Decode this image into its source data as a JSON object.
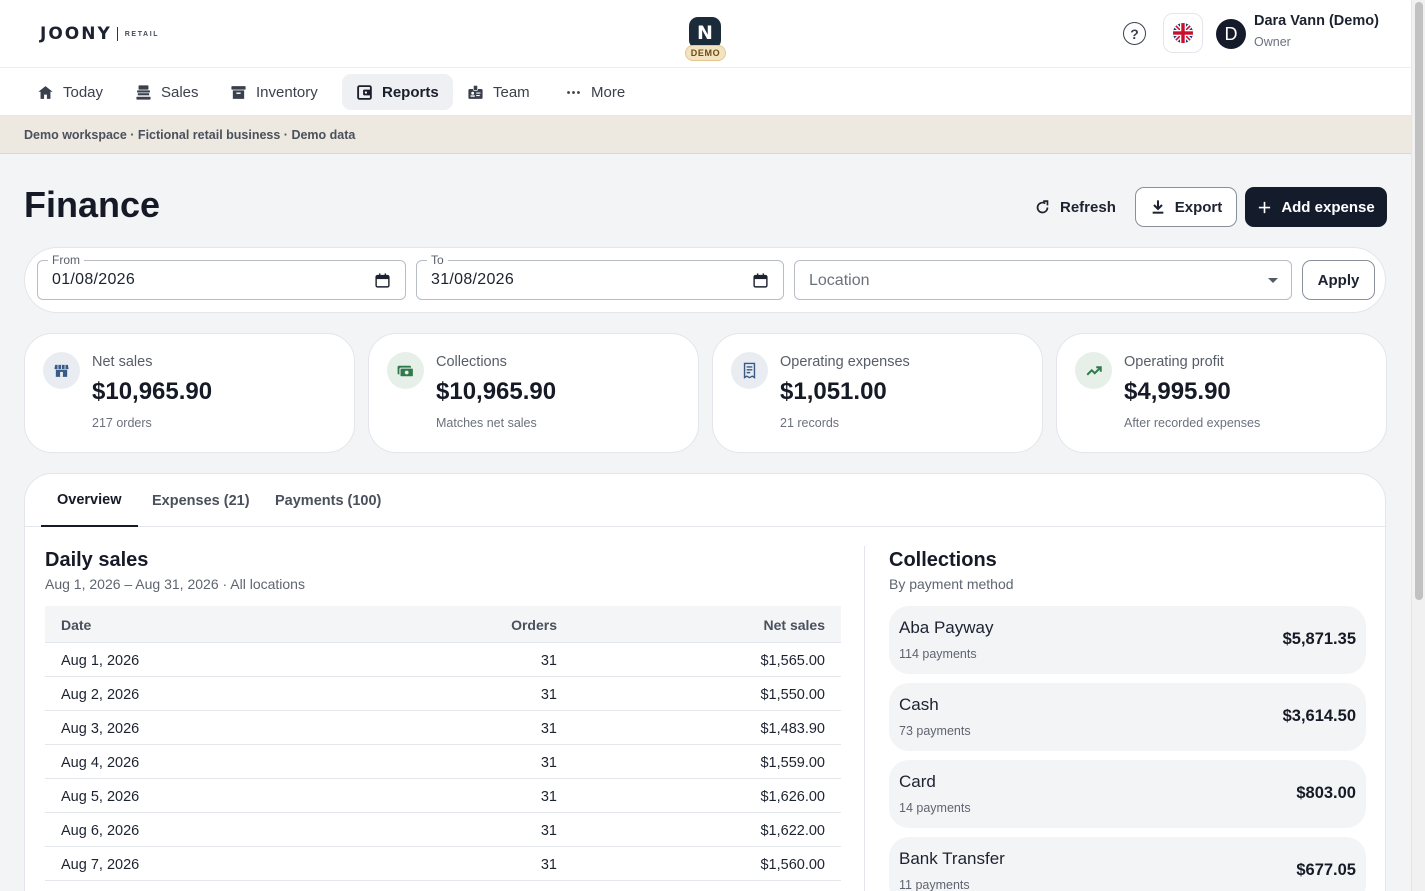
{
  "brand": {
    "name": "JOONY",
    "sub": "RETAIL"
  },
  "logo": {
    "letter": "N",
    "tag": "DEMO"
  },
  "header": {
    "help_icon": "help-circle-icon",
    "language_flag": "uk-flag-icon"
  },
  "user": {
    "initial": "D",
    "name": "Dara Vann (Demo)",
    "role": "Owner"
  },
  "nav": {
    "items": [
      {
        "label": "Today",
        "icon": "home-icon"
      },
      {
        "label": "Sales",
        "icon": "register-icon"
      },
      {
        "label": "Inventory",
        "icon": "archive-box-icon"
      },
      {
        "label": "Reports",
        "icon": "wallet-icon"
      },
      {
        "label": "Team",
        "icon": "badge-icon"
      },
      {
        "label": "More",
        "icon": "more-dots-icon"
      }
    ],
    "active": "Reports"
  },
  "banner": {
    "text": "Demo workspace · Fictional retail business · Demo data"
  },
  "page": {
    "title": "Finance"
  },
  "actions": {
    "refresh": "Refresh",
    "export": "Export",
    "add_expense": "Add expense"
  },
  "filters": {
    "from_label": "From",
    "from_value": "01/08/2026",
    "to_label": "To",
    "to_value": "31/08/2026",
    "location_placeholder": "Location",
    "apply": "Apply"
  },
  "kpis": [
    {
      "label": "Net sales",
      "value": "$10,965.90",
      "sub": "217 orders",
      "icon": "store-icon",
      "icon_bg": "#e9edf2",
      "icon_color": "#3a5a86"
    },
    {
      "label": "Collections",
      "value": "$10,965.90",
      "sub": "Matches net sales",
      "icon": "cash-icon",
      "icon_bg": "#e7efe9",
      "icon_color": "#2f7a4c"
    },
    {
      "label": "Operating expenses",
      "value": "$1,051.00",
      "sub": "21 records",
      "icon": "receipt-icon",
      "icon_bg": "#e9edf2",
      "icon_color": "#3a5a86"
    },
    {
      "label": "Operating profit",
      "value": "$4,995.90",
      "sub": "After recorded expenses",
      "icon": "trending-up-icon",
      "icon_bg": "#e7efe9",
      "icon_color": "#2f7a4c"
    }
  ],
  "tabs": [
    {
      "label": "Overview"
    },
    {
      "label": "Expenses (21)"
    },
    {
      "label": "Payments (100)"
    }
  ],
  "daily_sales": {
    "title": "Daily sales",
    "subtitle": "Aug 1, 2026 – Aug 31, 2026 · All locations",
    "columns": [
      "Date",
      "Orders",
      "Net sales"
    ],
    "rows": [
      {
        "date": "Aug 1, 2026",
        "orders": "31",
        "net": "$1,565.00"
      },
      {
        "date": "Aug 2, 2026",
        "orders": "31",
        "net": "$1,550.00"
      },
      {
        "date": "Aug 3, 2026",
        "orders": "31",
        "net": "$1,483.90"
      },
      {
        "date": "Aug 4, 2026",
        "orders": "31",
        "net": "$1,559.00"
      },
      {
        "date": "Aug 5, 2026",
        "orders": "31",
        "net": "$1,626.00"
      },
      {
        "date": "Aug 6, 2026",
        "orders": "31",
        "net": "$1,622.00"
      },
      {
        "date": "Aug 7, 2026",
        "orders": "31",
        "net": "$1,560.00"
      }
    ]
  },
  "collections": {
    "title": "Collections",
    "subtitle": "By payment method",
    "items": [
      {
        "name": "Aba Payway",
        "count": "114 payments",
        "amount": "$5,871.35"
      },
      {
        "name": "Cash",
        "count": "73 payments",
        "amount": "$3,614.50"
      },
      {
        "name": "Card",
        "count": "14 payments",
        "amount": "$803.00"
      },
      {
        "name": "Bank Transfer",
        "count": "11 payments",
        "amount": "$677.05"
      }
    ]
  }
}
